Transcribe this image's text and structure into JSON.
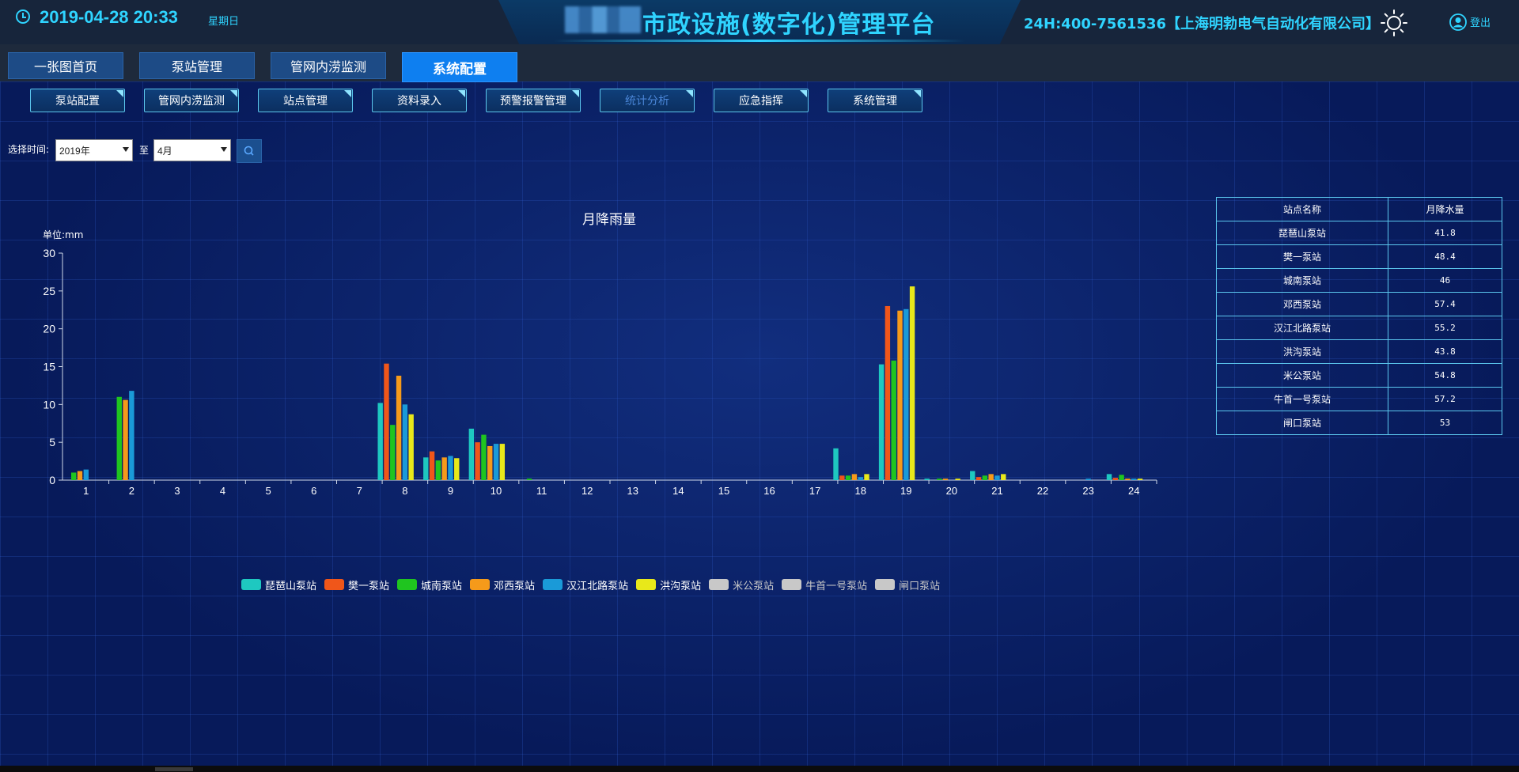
{
  "header": {
    "datetime": "2019-04-28 20:33",
    "weekday": "星期日",
    "platform_title": "市政设施(数字化)管理平台",
    "hotline": "24H:400-7561536【上海明勃电气自动化有限公司】",
    "logout_label": "登出"
  },
  "nav": {
    "tabs": [
      {
        "label": "一张图首页",
        "active": false
      },
      {
        "label": "泵站管理",
        "active": false
      },
      {
        "label": "管网内涝监测",
        "active": false
      },
      {
        "label": "系统配置",
        "active": true
      }
    ]
  },
  "subnav": {
    "items": [
      {
        "label": "泵站配置",
        "dim": false
      },
      {
        "label": "管网内涝监测",
        "dim": false
      },
      {
        "label": "站点管理",
        "dim": false
      },
      {
        "label": "资料录入",
        "dim": false
      },
      {
        "label": "预警报警管理",
        "dim": false
      },
      {
        "label": "统计分析",
        "dim": true
      },
      {
        "label": "应急指挥",
        "dim": false
      },
      {
        "label": "系统管理",
        "dim": false
      }
    ]
  },
  "filter": {
    "label": "选择时间:",
    "year_value": "2019年",
    "to_label": "至",
    "month_value": "4月"
  },
  "colors": {
    "accent": "#2fd4ff",
    "active_tab": "#0e7ff0"
  },
  "chart_data": {
    "type": "bar",
    "title": "月降雨量",
    "ylabel": "单位:mm",
    "xlabel": "",
    "ylim": [
      0,
      30
    ],
    "yticks": [
      0,
      5,
      10,
      15,
      20,
      25,
      30
    ],
    "categories": [
      "1",
      "2",
      "3",
      "4",
      "5",
      "6",
      "7",
      "8",
      "9",
      "10",
      "11",
      "12",
      "13",
      "14",
      "15",
      "16",
      "17",
      "18",
      "19",
      "20",
      "21",
      "22",
      "23",
      "24"
    ],
    "series": [
      {
        "name": "琵琶山泵站",
        "color": "#1ec8c0",
        "values": [
          0,
          0,
          0,
          0,
          0,
          0,
          0,
          10.2,
          3,
          6.8,
          0,
          0,
          0,
          0,
          0,
          0,
          0,
          4.2,
          15.3,
          0.2,
          1.2,
          0,
          0,
          0.8
        ]
      },
      {
        "name": "樊一泵站",
        "color": "#f0561a",
        "values": [
          0,
          0,
          0,
          0,
          0,
          0,
          0,
          15.4,
          3.8,
          5,
          0,
          0,
          0,
          0,
          0,
          0,
          0,
          0.6,
          23,
          0,
          0.4,
          0,
          0,
          0.3
        ]
      },
      {
        "name": "城南泵站",
        "color": "#1fc51f",
        "values": [
          1,
          11,
          0,
          0,
          0,
          0,
          0,
          7.3,
          2.6,
          6,
          0.2,
          0,
          0,
          0,
          0,
          0,
          0,
          0.6,
          15.8,
          0.2,
          0.6,
          0,
          0,
          0.7
        ]
      },
      {
        "name": "邓西泵站",
        "color": "#f59a1a",
        "values": [
          1.2,
          10.6,
          0,
          0,
          0,
          0,
          0,
          13.8,
          3,
          4.5,
          0,
          0,
          0,
          0,
          0,
          0,
          0,
          0.8,
          22.4,
          0.2,
          0.8,
          0,
          0,
          0.2
        ]
      },
      {
        "name": "汉江北路泵站",
        "color": "#1a9ad8",
        "values": [
          1.4,
          11.8,
          0,
          0,
          0,
          0,
          0,
          10,
          3.2,
          4.8,
          0,
          0,
          0,
          0,
          0,
          0,
          0,
          0.4,
          22.6,
          0,
          0.6,
          0,
          0.2,
          0.2
        ]
      },
      {
        "name": "洪沟泵站",
        "color": "#e8e81a",
        "values": [
          0,
          0,
          0,
          0,
          0,
          0,
          0,
          8.7,
          2.9,
          4.8,
          0,
          0,
          0,
          0,
          0,
          0,
          0,
          0.8,
          25.6,
          0.2,
          0.8,
          0,
          0,
          0.2
        ]
      },
      {
        "name": "米公泵站",
        "color": "#c8c8c8",
        "values": [
          0,
          0,
          0,
          0,
          0,
          0,
          0,
          0,
          0,
          0,
          0,
          0,
          0,
          0,
          0,
          0,
          0,
          0,
          0,
          0,
          0,
          0,
          0,
          0
        ]
      },
      {
        "name": "牛首一号泵站",
        "color": "#c8c8c8",
        "values": [
          0,
          0,
          0,
          0,
          0,
          0,
          0,
          0,
          0,
          0,
          0,
          0,
          0,
          0,
          0,
          0,
          0,
          0,
          0,
          0,
          0,
          0,
          0,
          0
        ]
      },
      {
        "name": "闸口泵站",
        "color": "#c8c8c8",
        "values": [
          0,
          0,
          0,
          0,
          0,
          0,
          0,
          0,
          0,
          0,
          0,
          0,
          0,
          0,
          0,
          0,
          0,
          0,
          0,
          0,
          0,
          0,
          0,
          0
        ]
      }
    ],
    "legend_dimmed": [
      "米公泵站",
      "牛首一号泵站",
      "闸口泵站"
    ],
    "legend_position": "bottom-center",
    "grid": false
  },
  "table": {
    "headers": [
      "站点名称",
      "月降水量"
    ],
    "rows": [
      [
        "琵琶山泵站",
        "41.8"
      ],
      [
        "樊一泵站",
        "48.4"
      ],
      [
        "城南泵站",
        "46"
      ],
      [
        "邓西泵站",
        "57.4"
      ],
      [
        "汉江北路泵站",
        "55.2"
      ],
      [
        "洪沟泵站",
        "43.8"
      ],
      [
        "米公泵站",
        "54.8"
      ],
      [
        "牛首一号泵站",
        "57.2"
      ],
      [
        "闸口泵站",
        "53"
      ]
    ]
  }
}
